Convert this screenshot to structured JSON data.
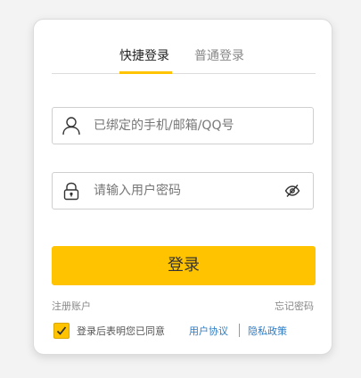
{
  "tabs": {
    "quick_login": "快捷登录",
    "normal_login": "普通登录"
  },
  "account": {
    "placeholder": "已绑定的手机/邮箱/QQ号",
    "icon": "user-icon"
  },
  "password": {
    "placeholder": "请输入用户密码",
    "icon": "lock-icon",
    "toggle_icon": "eye-hidden-icon"
  },
  "login_button": "登录",
  "links": {
    "register": "注册账户",
    "forgot_password": "忘记密码"
  },
  "agreement": {
    "checked": true,
    "text": "登录后表明您已同意",
    "user_agreement": "用户协议",
    "privacy_policy": "隐私政策"
  },
  "colors": {
    "accent": "#ffc300",
    "link": "#2d7bc4"
  }
}
